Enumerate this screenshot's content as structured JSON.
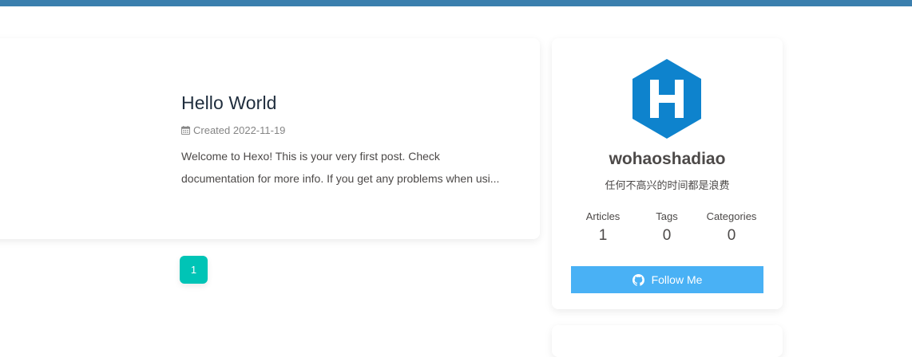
{
  "colors": {
    "topbar": "#3b7fae",
    "accent_teal": "#00c4b6",
    "follow_blue": "#49b1f5",
    "hexo_blue": "#0e83cd"
  },
  "post": {
    "title": "Hello World",
    "meta_icon": "calendar-icon",
    "meta_prefix": "Created",
    "date": "2022-11-19",
    "excerpt_line1": "Welcome to Hexo! This is your very first post. Check",
    "excerpt_line2": "documentation for more info. If you get any problems when usi..."
  },
  "pagination": {
    "current_page": "1"
  },
  "profile": {
    "avatar_icon": "hexo-logo",
    "avatar_letter": "H",
    "name": "wohaoshadiao",
    "description": "任何不高兴的时间都是浪费",
    "stats": [
      {
        "label": "Articles",
        "value": "1"
      },
      {
        "label": "Tags",
        "value": "0"
      },
      {
        "label": "Categories",
        "value": "0"
      }
    ],
    "follow_icon": "github-icon",
    "follow_label": "Follow Me"
  }
}
